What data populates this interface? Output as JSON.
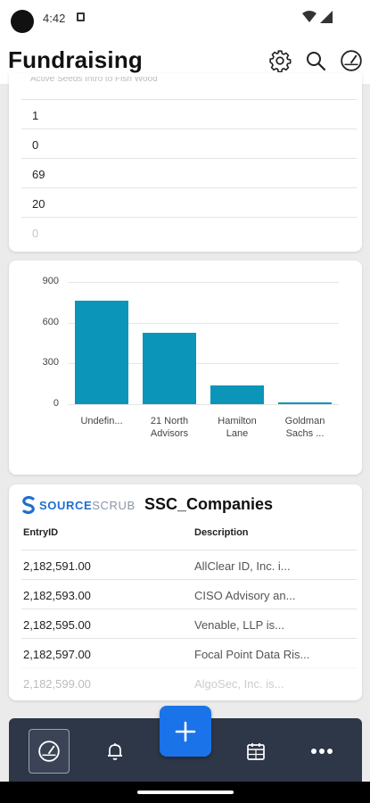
{
  "status": {
    "time": "4:42"
  },
  "header": {
    "title": "Fundraising"
  },
  "list_card": {
    "partial_header": "Active Seeds Intro to Fish Wood",
    "rows": [
      "1",
      "0",
      "69",
      "20",
      "0"
    ]
  },
  "chart_data": {
    "type": "bar",
    "categories": [
      "Undefin...",
      "21 North Advisors",
      "Hamilton Lane",
      "Goldman Sachs ..."
    ],
    "category_lines": [
      [
        "Undefin..."
      ],
      [
        "21 North",
        "Advisors"
      ],
      [
        "Hamilton",
        "Lane"
      ],
      [
        "Goldman",
        "Sachs ..."
      ]
    ],
    "values": [
      760,
      525,
      140,
      10
    ],
    "ylim": [
      0,
      900
    ],
    "yticks": [
      0,
      300,
      600,
      900
    ],
    "color": "#0b95b8",
    "grid": true
  },
  "ssc_card": {
    "logo_text_1": "SOURCE",
    "logo_text_2": "SCRUB",
    "title": "SSC_Companies",
    "columns": [
      "EntryID",
      "Description"
    ],
    "rows": [
      {
        "entry_id": "2,182,591.00",
        "description": "AllClear ID, Inc. i..."
      },
      {
        "entry_id": "2,182,593.00",
        "description": "CISO Advisory an..."
      },
      {
        "entry_id": "2,182,595.00",
        "description": "Venable, LLP is..."
      },
      {
        "entry_id": "2,182,597.00",
        "description": "Focal Point Data Ris..."
      },
      {
        "entry_id": "2,182,599.00",
        "description": "AlgoSec, Inc. is..."
      }
    ]
  },
  "bottom_nav": {
    "items": [
      "dashboard-icon",
      "bell-icon",
      "calendar-icon",
      "more-icon"
    ],
    "fab": "plus-icon"
  },
  "colors": {
    "accent": "#1a73e8",
    "bar": "#0b95b8",
    "nav_bg": "#2e3748",
    "logo_blue": "#1e6fd0",
    "logo_grey": "#8a95a5"
  }
}
